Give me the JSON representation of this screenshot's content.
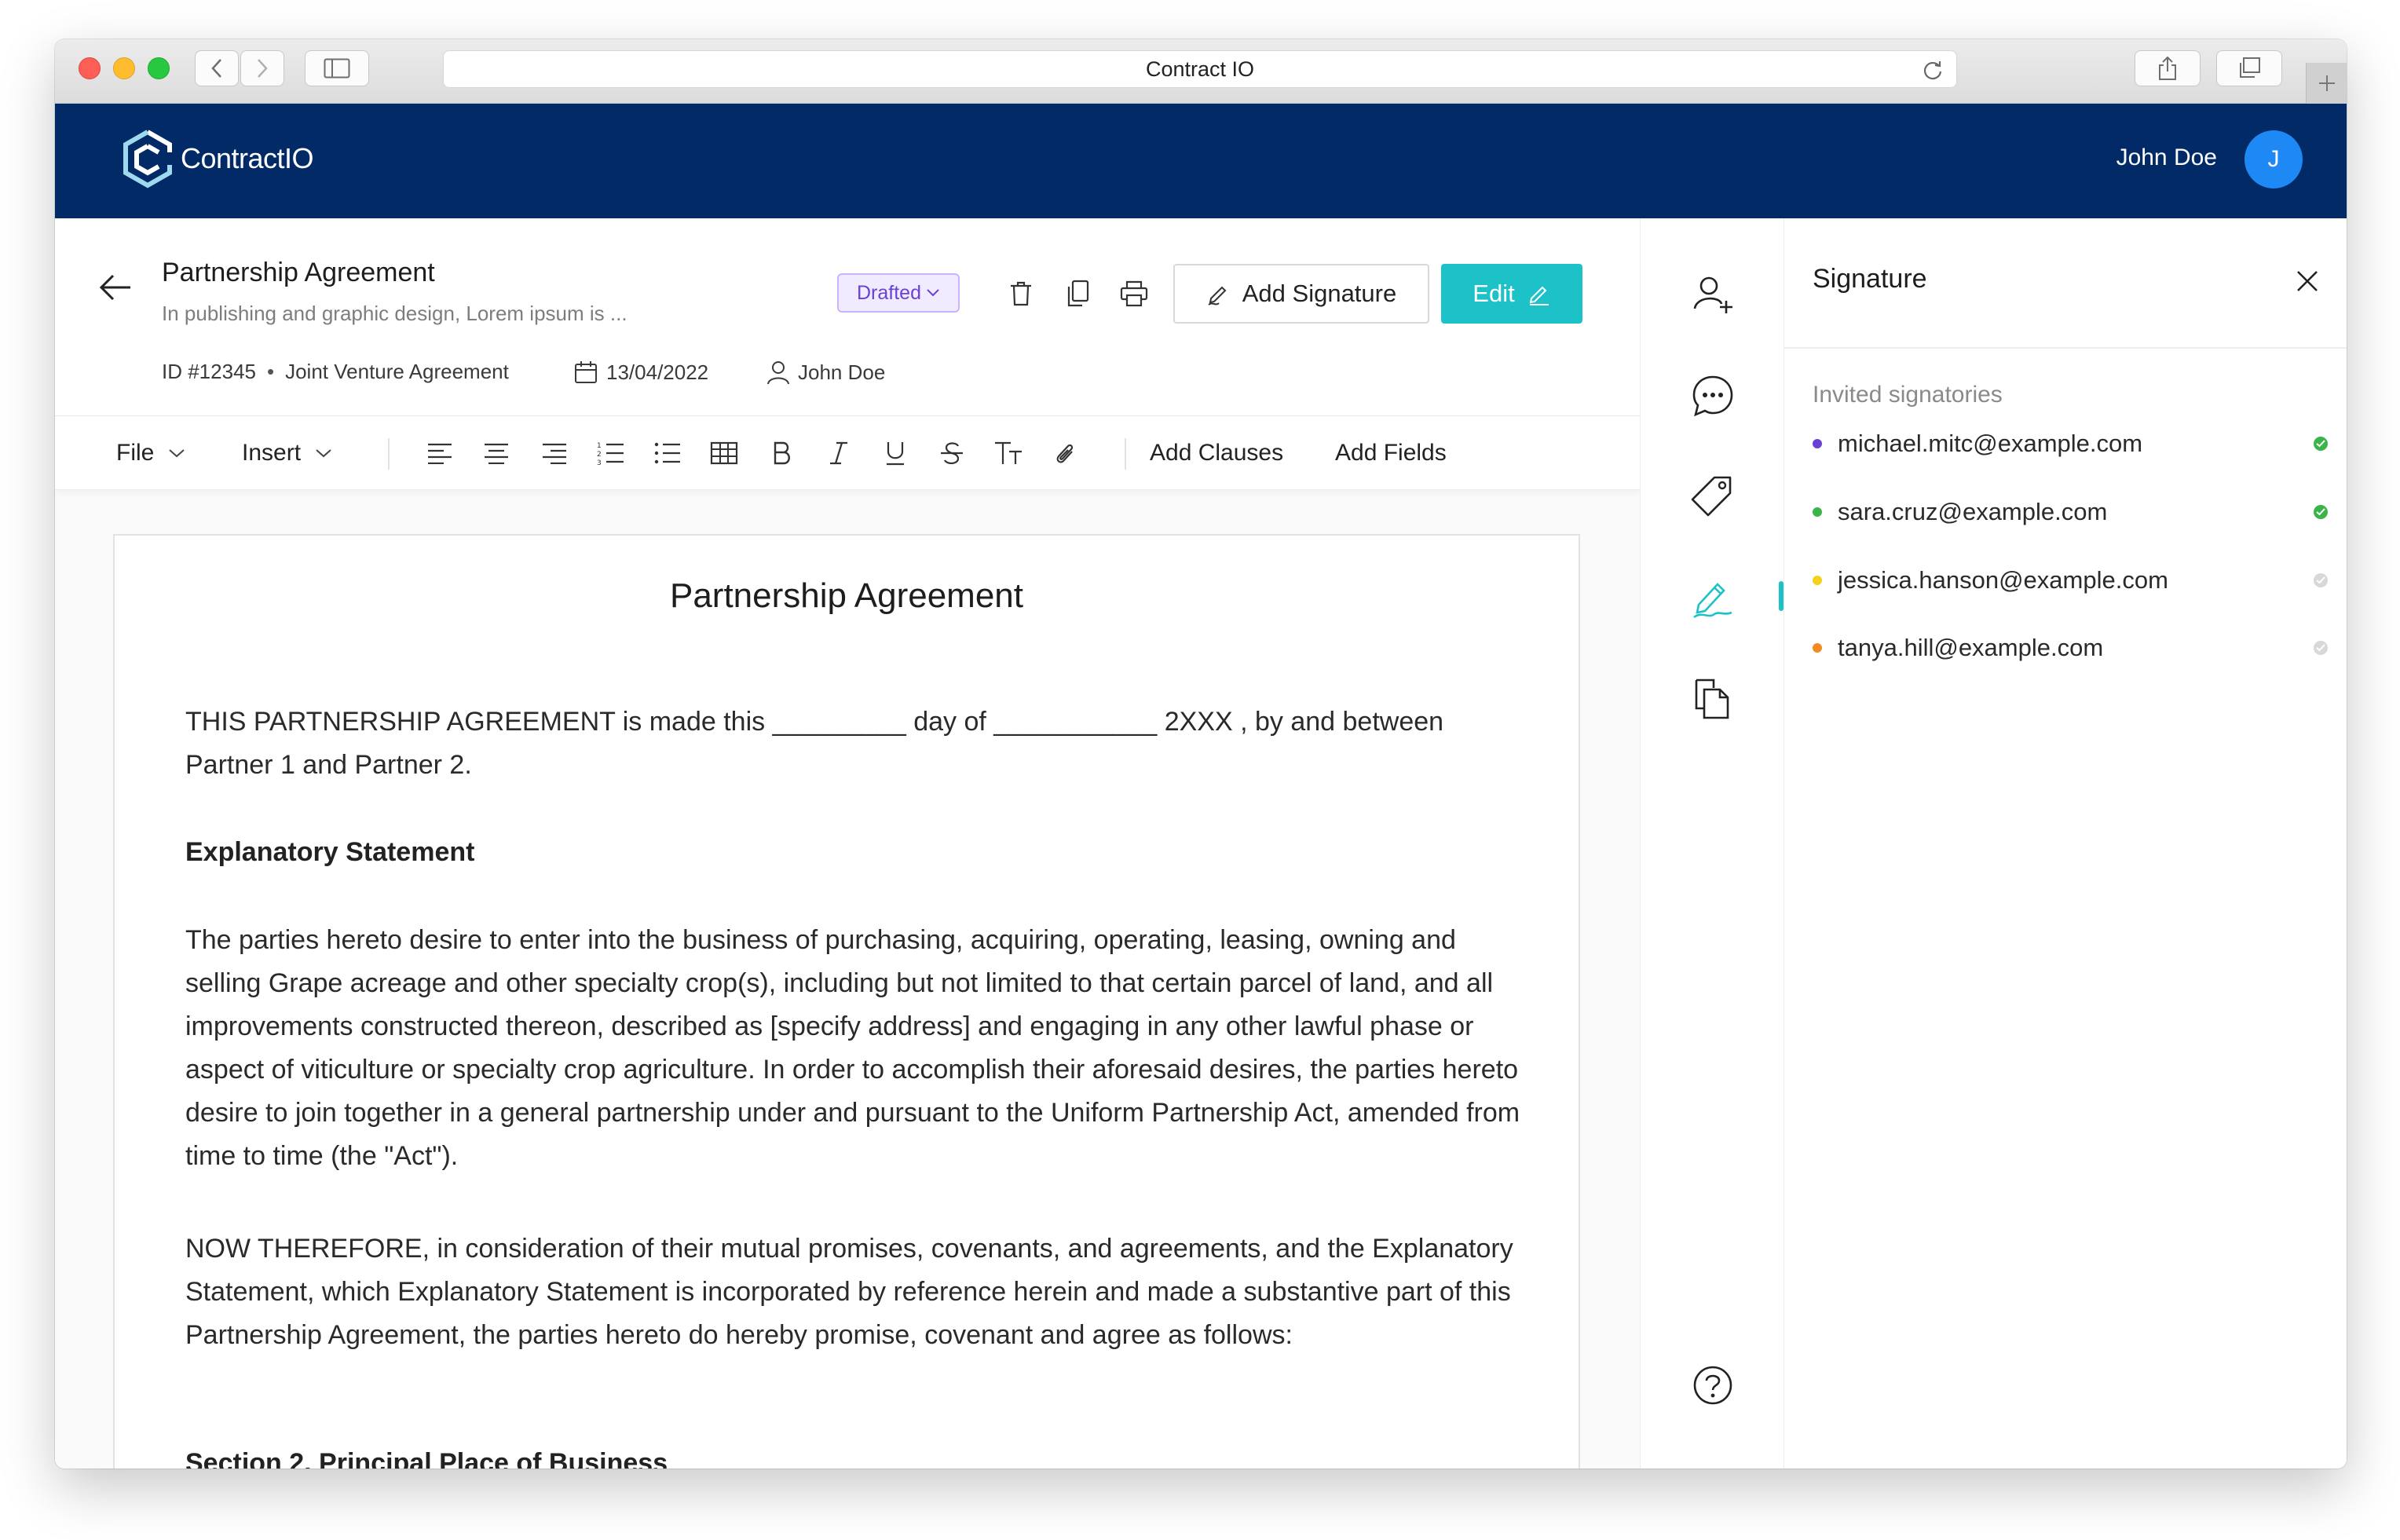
{
  "browser": {
    "url_title": "Contract IO"
  },
  "header": {
    "logo_text": "ContractIO",
    "user_name": "John Doe",
    "avatar_initial": "J"
  },
  "document": {
    "title": "Partnership Agreement",
    "subtitle": "In publishing and graphic design, Lorem ipsum is ...",
    "id": "ID #12345",
    "type": "Joint Venture Agreement",
    "date": "13/04/2022",
    "owner": "John Doe",
    "status": "Drafted",
    "add_signature_label": "Add Signature",
    "edit_label": "Edit"
  },
  "toolbar": {
    "file_label": "File",
    "insert_label": "Insert",
    "add_clauses_label": "Add Clauses",
    "add_fields_label": "Add Fields"
  },
  "paper": {
    "heading": "Partnership Agreement",
    "intro": "THIS PARTNERSHIP AGREEMENT is made this _________ day of ___________ 2XXX , by and between Partner 1 and Partner 2.",
    "explanatory_heading": "Explanatory Statement",
    "explanatory_body": "The parties hereto desire to enter into the business of purchasing, acquiring, operating, leasing, owning and selling Grape acreage and other specialty crop(s), including but not limited to that certain parcel of land, and all improvements constructed thereon, described as [specify address] and engaging in any other lawful phase or aspect of viticulture or specialty crop agriculture. In order to accomplish their aforesaid desires, the parties hereto desire to join together in a general partnership under and pursuant to the Uniform Partnership Act, amended from time to time (the \"Act\").",
    "now_therefore": "NOW THEREFORE, in consideration of their mutual promises, covenants, and agreements, and the Explanatory Statement, which Explanatory Statement is incorporated by reference herein and made a substantive part of this Partnership Agreement, the parties hereto do hereby promise, covenant and agree as follows:",
    "section2_heading": "Section 2. Principal Place of Business"
  },
  "signature_panel": {
    "title": "Signature",
    "invited_label": "Invited signatories",
    "signatories": [
      {
        "email": "michael.mitc@example.com",
        "color": "#6a3fd6",
        "signed": true
      },
      {
        "email": "sara.cruz@example.com",
        "color": "#3bb54a",
        "signed": true
      },
      {
        "email": "jessica.hanson@example.com",
        "color": "#f2d21b",
        "signed": false
      },
      {
        "email": "tanya.hill@example.com",
        "color": "#f28a1d",
        "signed": false
      }
    ]
  },
  "colors": {
    "appbar": "#012a66",
    "accent": "#1dc1c8",
    "avatar": "#1e88f5",
    "status_text": "#6a41d6",
    "signed": "#3bb54a",
    "pending": "#d8d8d8"
  }
}
